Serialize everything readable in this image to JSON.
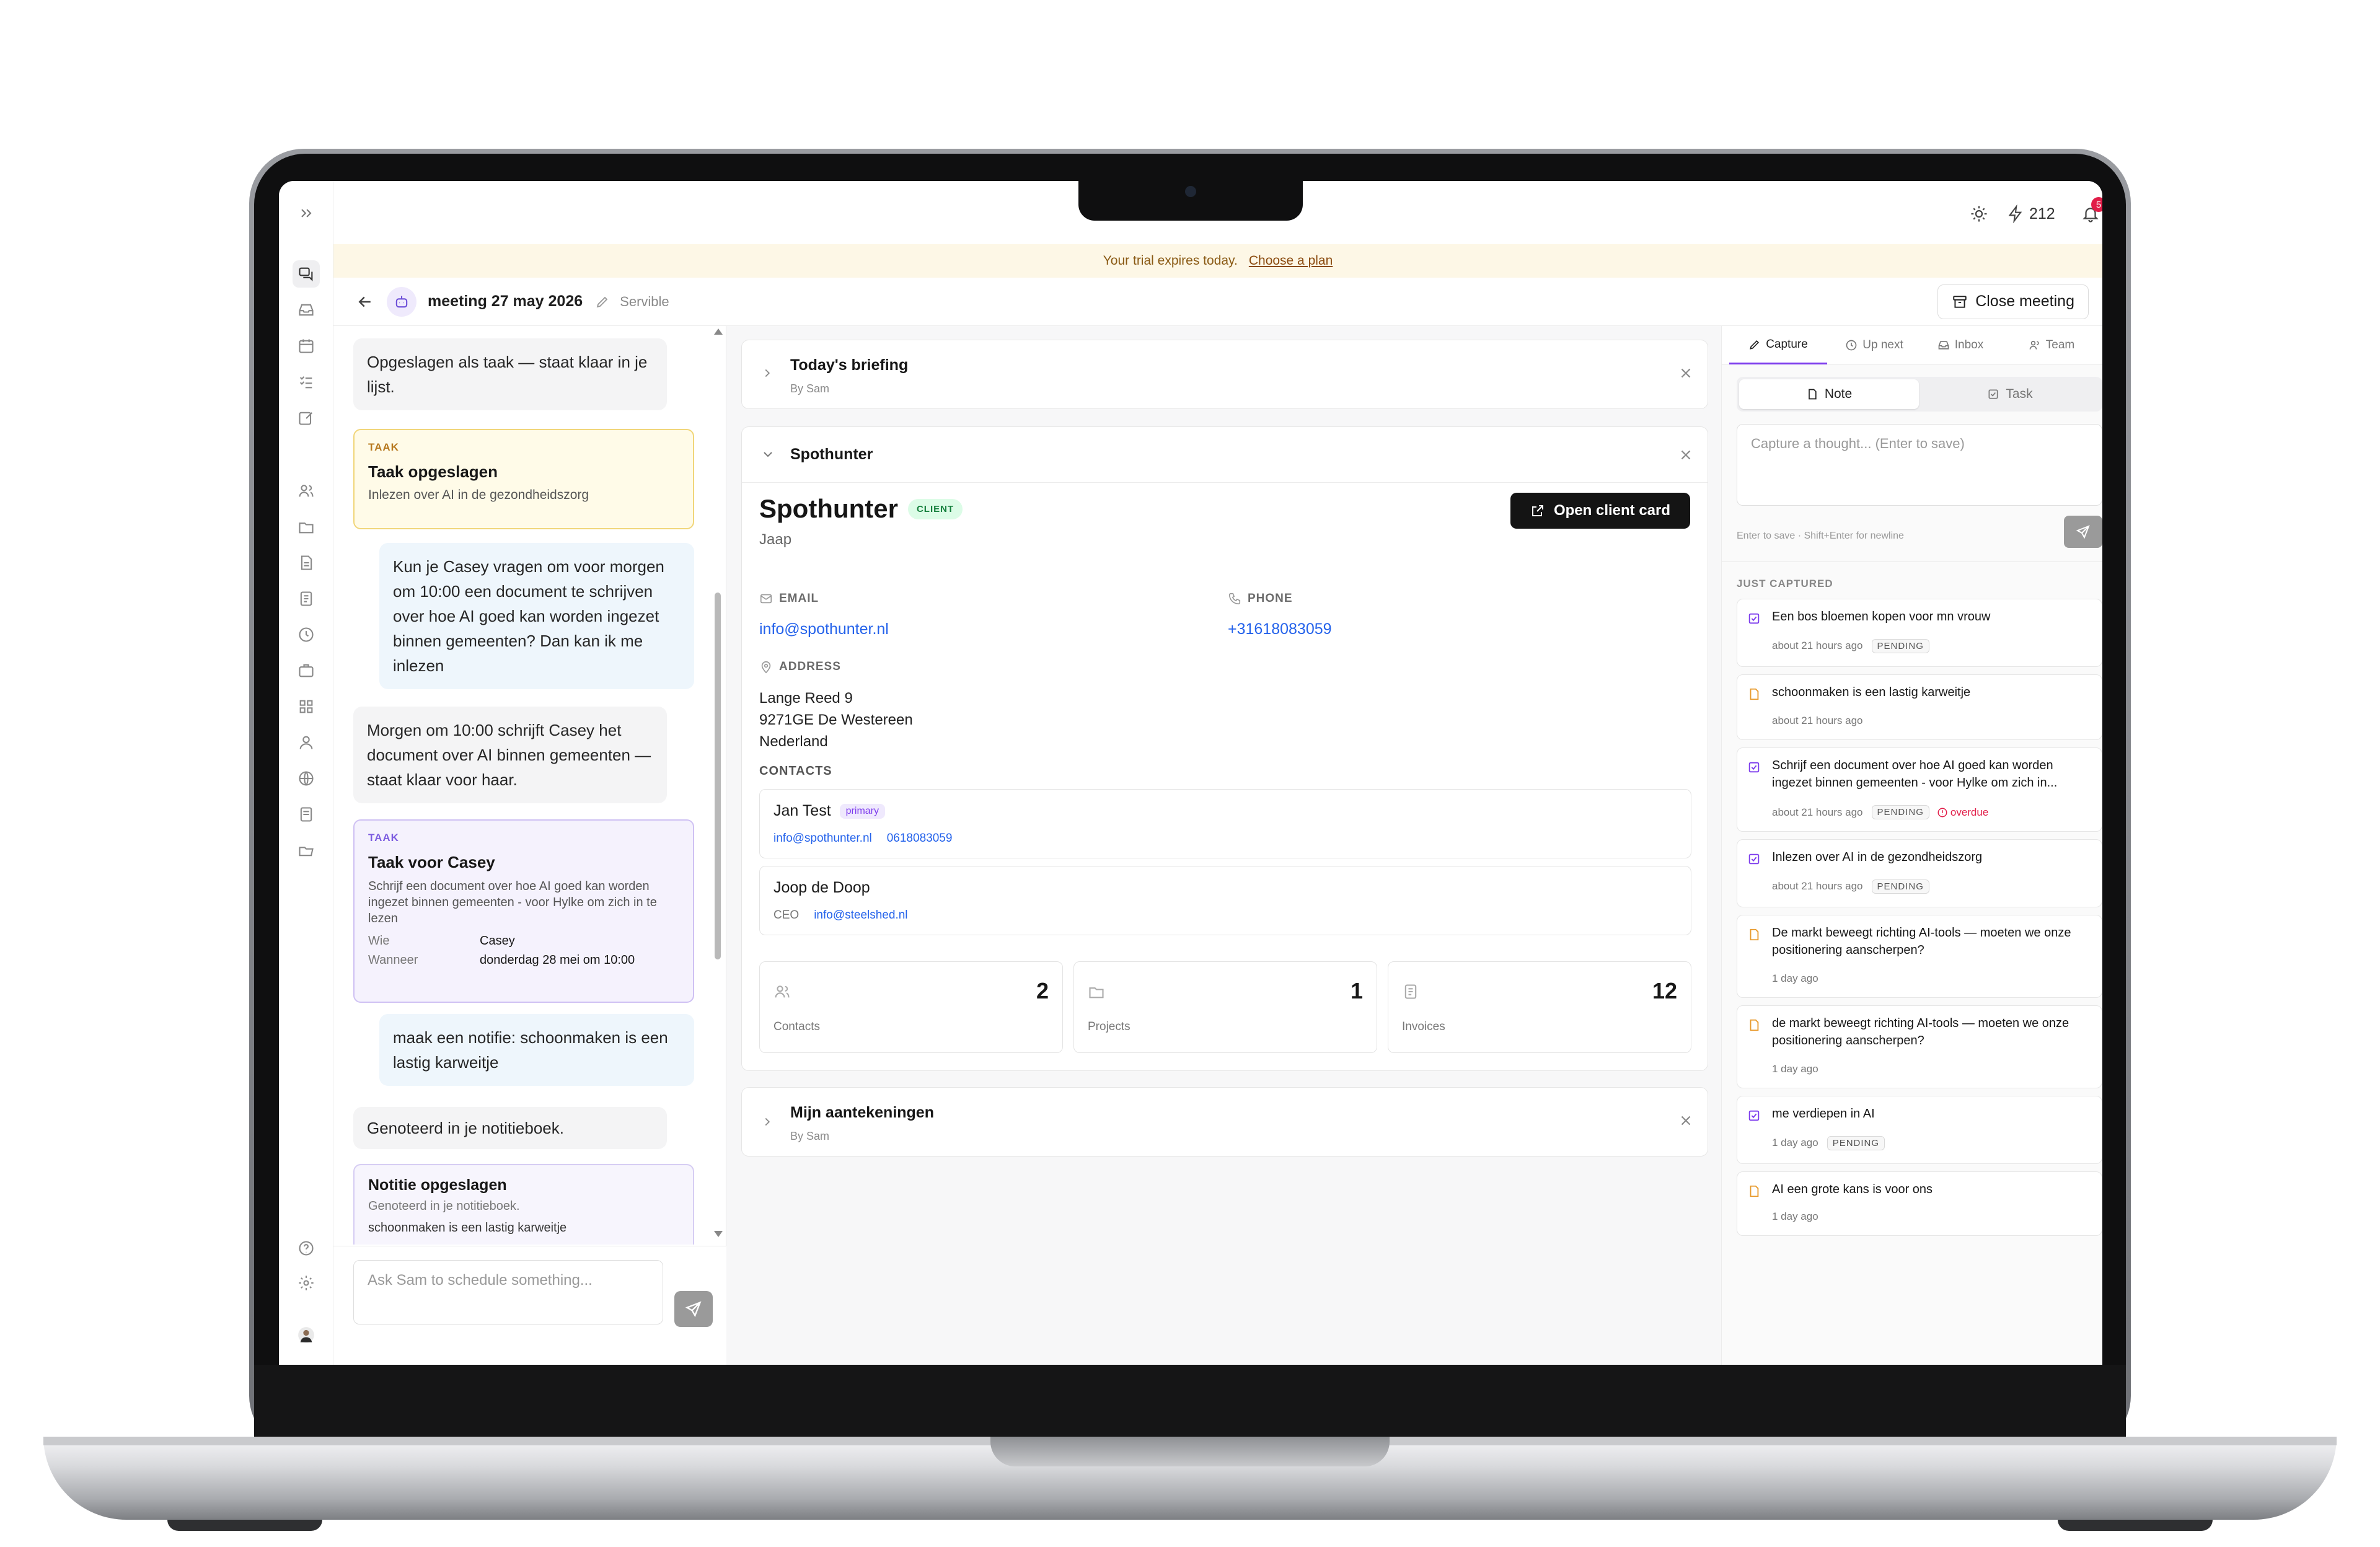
{
  "topbar": {
    "credits": "212",
    "notifications": "5"
  },
  "trial": {
    "text": "Your trial expires today.",
    "link": "Choose a plan"
  },
  "header": {
    "title": "meeting 27 may 2026",
    "subtitle": "Servible",
    "close_label": "Close meeting"
  },
  "chat": {
    "messages": [
      {
        "text": "Opgeslagen als taak — staat klaar in je lijst."
      },
      {
        "tag": "TAAK",
        "title": "Taak opgeslagen",
        "body": "Inlezen over AI in de gezondheidszorg"
      },
      {
        "text": "Kun je Casey vragen om voor morgen om 10:00 een document te schrijven over hoe AI goed kan worden ingezet binnen gemeenten? Dan kan ik me inlezen"
      },
      {
        "text": "Morgen om 10:00 schrijft Casey het document over AI binnen gemeenten — staat klaar voor haar."
      },
      {
        "tag": "TAAK",
        "title": "Taak voor Casey",
        "body": "Schrijf een document over hoe AI goed kan worden ingezet binnen gemeenten - voor Hylke om zich in te lezen",
        "who_label": "Wie",
        "who": "Casey",
        "when_label": "Wanneer",
        "when": "donderdag 28 mei om 10:00"
      },
      {
        "text": "maak een notifie: schoonmaken is een lastig karweitje"
      },
      {
        "text": "Genoteerd in je notitieboek."
      },
      {
        "title": "Notitie opgeslagen",
        "sub": "Genoteerd in je notitieboek.",
        "body": "schoonmaken is een lastig karweitje"
      }
    ],
    "input_placeholder": "Ask Sam to schedule something..."
  },
  "briefing": {
    "title": "Today's briefing",
    "by": "By Sam"
  },
  "client": {
    "section_title": "Spothunter",
    "name": "Spothunter",
    "badge": "CLIENT",
    "contact_name": "Jaap",
    "open_label": "Open client card",
    "email_label": "EMAIL",
    "email": "info@spothunter.nl",
    "phone_label": "PHONE",
    "phone": "+31618083059",
    "address_label": "ADDRESS",
    "address": [
      "Lange Reed 9",
      "9271GE De Westereen",
      "Nederland"
    ],
    "contacts_label": "CONTACTS",
    "contacts": [
      {
        "name": "Jan Test",
        "badge": "primary",
        "line1": "info@spothunter.nl",
        "line2": "0618083059"
      },
      {
        "name": "Joop de Doop",
        "line1": "CEO",
        "line2": "info@steelshed.nl"
      }
    ],
    "stats": [
      {
        "label": "Contacts",
        "value": "2"
      },
      {
        "label": "Projects",
        "value": "1"
      },
      {
        "label": "Invoices",
        "value": "12"
      }
    ]
  },
  "notes_section": {
    "title": "Mijn aantekeningen",
    "by": "By Sam"
  },
  "right": {
    "tabs": [
      "Capture",
      "Up next",
      "Inbox",
      "Team"
    ],
    "toggle": [
      "Note",
      "Task"
    ],
    "capture_placeholder": "Capture a thought... (Enter to save)",
    "hint": "Enter to save · Shift+Enter for newline",
    "just_captured": "JUST CAPTURED",
    "items": [
      {
        "kind": "task",
        "text": "Een bos bloemen kopen voor mn vrouw",
        "ago": "about 21 hours ago",
        "status": "PENDING"
      },
      {
        "kind": "note",
        "text": "schoonmaken is een lastig karweitje",
        "ago": "about 21 hours ago"
      },
      {
        "kind": "task",
        "text": "Schrijf een document over hoe AI goed kan worden ingezet binnen gemeenten - voor Hylke om zich in...",
        "ago": "about 21 hours ago",
        "status": "PENDING",
        "overdue": "overdue"
      },
      {
        "kind": "task",
        "text": "Inlezen over AI in de gezondheidszorg",
        "ago": "about 21 hours ago",
        "status": "PENDING"
      },
      {
        "kind": "note",
        "text": "De markt beweegt richting AI-tools — moeten we onze positionering aanscherpen?",
        "ago": "1 day ago"
      },
      {
        "kind": "note",
        "text": "de markt beweegt richting AI-tools — moeten we onze positionering aanscherpen?",
        "ago": "1 day ago"
      },
      {
        "kind": "task",
        "text": "me verdiepen in AI",
        "ago": "1 day ago",
        "status": "PENDING"
      },
      {
        "kind": "note",
        "text": "AI een grote kans is voor ons",
        "ago": "1 day ago"
      }
    ]
  }
}
